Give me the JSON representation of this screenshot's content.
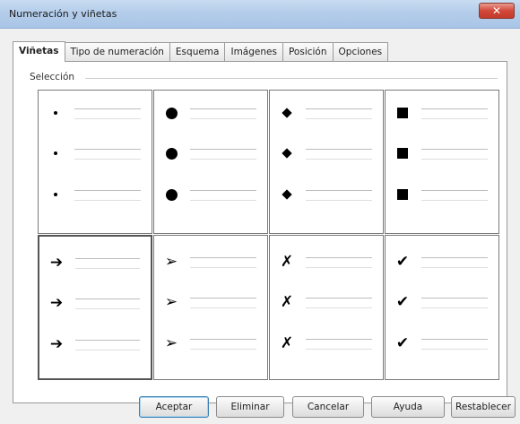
{
  "window": {
    "title": "Numeración y viñetas",
    "close_label": "✕"
  },
  "tabs": [
    {
      "label": "Viñetas",
      "active": true
    },
    {
      "label": "Tipo de numeración"
    },
    {
      "label": "Esquema"
    },
    {
      "label": "Imágenes"
    },
    {
      "label": "Posición"
    },
    {
      "label": "Opciones"
    }
  ],
  "section": {
    "label": "Selección"
  },
  "bullets": [
    {
      "name": "small-dot",
      "icon": "small-dot-icon",
      "selected": false
    },
    {
      "name": "large-dot",
      "icon": "large-dot-icon",
      "selected": false
    },
    {
      "name": "diamond",
      "icon": "diamond-icon",
      "selected": false
    },
    {
      "name": "square",
      "icon": "square-icon",
      "selected": false
    },
    {
      "name": "arrow",
      "icon": "arrow-icon",
      "glyph": "➔",
      "selected": true
    },
    {
      "name": "arrowhead",
      "icon": "arrowhead-icon",
      "glyph": "➢",
      "selected": false
    },
    {
      "name": "x-mark",
      "icon": "x-mark-icon",
      "glyph": "✗",
      "selected": false
    },
    {
      "name": "check-mark",
      "icon": "check-mark-icon",
      "glyph": "✔",
      "selected": false
    }
  ],
  "buttons": {
    "ok": "Aceptar",
    "delete": "Eliminar",
    "cancel": "Cancelar",
    "help": "Ayuda",
    "reset": "Restablecer"
  }
}
